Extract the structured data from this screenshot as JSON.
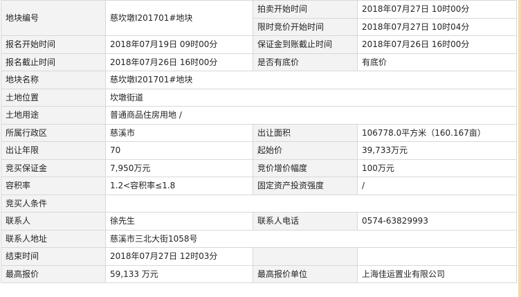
{
  "rows": {
    "parcel_no_label": "地块编号",
    "parcel_no_value": "慈坎墩I201701#地块",
    "auction_start_label": "拍卖开始时间",
    "auction_start_value": "2018年07月27日 10时00分",
    "limit_bid_start_label": "限时竞价开始时间",
    "limit_bid_start_value": "2018年07月27日 10时04分",
    "reg_start_label": "报名开始时间",
    "reg_start_value": "2018年07月19日 09时00分",
    "deposit_deadline_label": "保证金到账截止时间",
    "deposit_deadline_value": "2018年07月26日 16时00分",
    "reg_end_label": "报名截止时间",
    "reg_end_value": "2018年07月26日 16时00分",
    "reserve_label": "是否有底价",
    "reserve_value": "有底价",
    "parcel_name_label": "地块名称",
    "parcel_name_value": "慈坎墩I201701#地块",
    "location_label": "土地位置",
    "location_value": "坎墩街道",
    "land_use_label": "土地用途",
    "land_use_value": "普通商品住房用地 /",
    "district_label": "所属行政区",
    "district_value": "慈溪市",
    "area_label": "出让面积",
    "area_value": "106778.0平方米（160.167亩）",
    "term_label": "出让年限",
    "term_value": "70",
    "start_price_label": "起始价",
    "start_price_value": "39,733万元",
    "bid_deposit_label": "竞买保证金",
    "bid_deposit_value": "7,950万元",
    "increment_label": "竞价增价幅度",
    "increment_value": "100万元",
    "far_label": "容积率",
    "far_value": "1.2<容积率≤1.8",
    "investment_label": "固定资产投资强度",
    "investment_value": "/",
    "conditions_label": "竞买人条件",
    "conditions_value": "",
    "contact_label": "联系人",
    "contact_value": "徐先生",
    "phone_label": "联系人电话",
    "phone_value": "0574-63829993",
    "address_label": "联系人地址",
    "address_value": "慈溪市三北大街1058号",
    "end_time_label": "结束时间",
    "end_time_value": "2018年07月27日 12时03分",
    "top_bid_label": "最高报价",
    "top_bid_value": "59,133 万元",
    "top_bidder_label": "最高报价单位",
    "top_bidder_value": "上海佳运置业有限公司"
  }
}
